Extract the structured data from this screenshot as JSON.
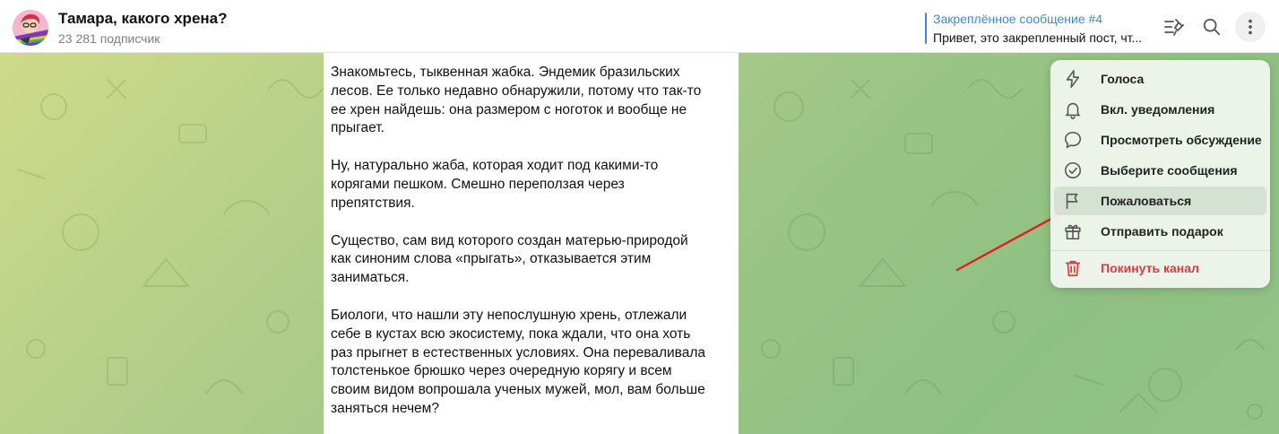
{
  "header": {
    "channel_title": "Тамара, какого хрена?",
    "subscribers": "23 281 подписчик",
    "pinned_label": "Закреплённое сообщение #4",
    "pinned_preview": "Привет, это закрепленный пост, чт..."
  },
  "post": {
    "paragraphs": [
      "Знакомьтесь, тыквенная жабка. Эндемик бразильских\nлесов. Ее только недавно обнаружили, потому что так-то\nее хрен найдешь: она размером с ноготок и вообще не\nпрыгает.",
      "Ну, натурально жаба, которая ходит под какими-то\nкорягами пешком. Смешно переползая через\nпрепятствия.",
      "Существо, сам вид которого создан матерью-природой\nкак синоним слова «прыгать», отказывается этим\nзаниматься.",
      "Биологи, что нашли эту непослушную хрень, отлежали\nсебе в кустах всю экосистему, пока ждали, что она хоть\nраз прыгнет в естественных условиях. Она переваливала\nтолстенькое брюшко через очередную корягу и всем\nсвоим видом вопрошала ученых мужей, мол, вам больше\nзаняться нечем?"
    ]
  },
  "menu": {
    "items": [
      {
        "label": "Голоса",
        "icon": "lightning-icon"
      },
      {
        "label": "Вкл. уведомления",
        "icon": "bell-icon"
      },
      {
        "label": "Просмотреть обсуждение",
        "icon": "comment-icon"
      },
      {
        "label": "Выберите сообщения",
        "icon": "check-circle-icon"
      },
      {
        "label": "Пожаловаться",
        "icon": "flag-icon",
        "highlighted": true
      },
      {
        "label": "Отправить подарок",
        "icon": "gift-icon"
      },
      {
        "label": "Покинуть канал",
        "icon": "trash-icon",
        "danger": true
      }
    ]
  },
  "colors": {
    "accent": "#3a8bd6",
    "danger": "#e5373d",
    "annotation_arrow": "#e0201e"
  }
}
